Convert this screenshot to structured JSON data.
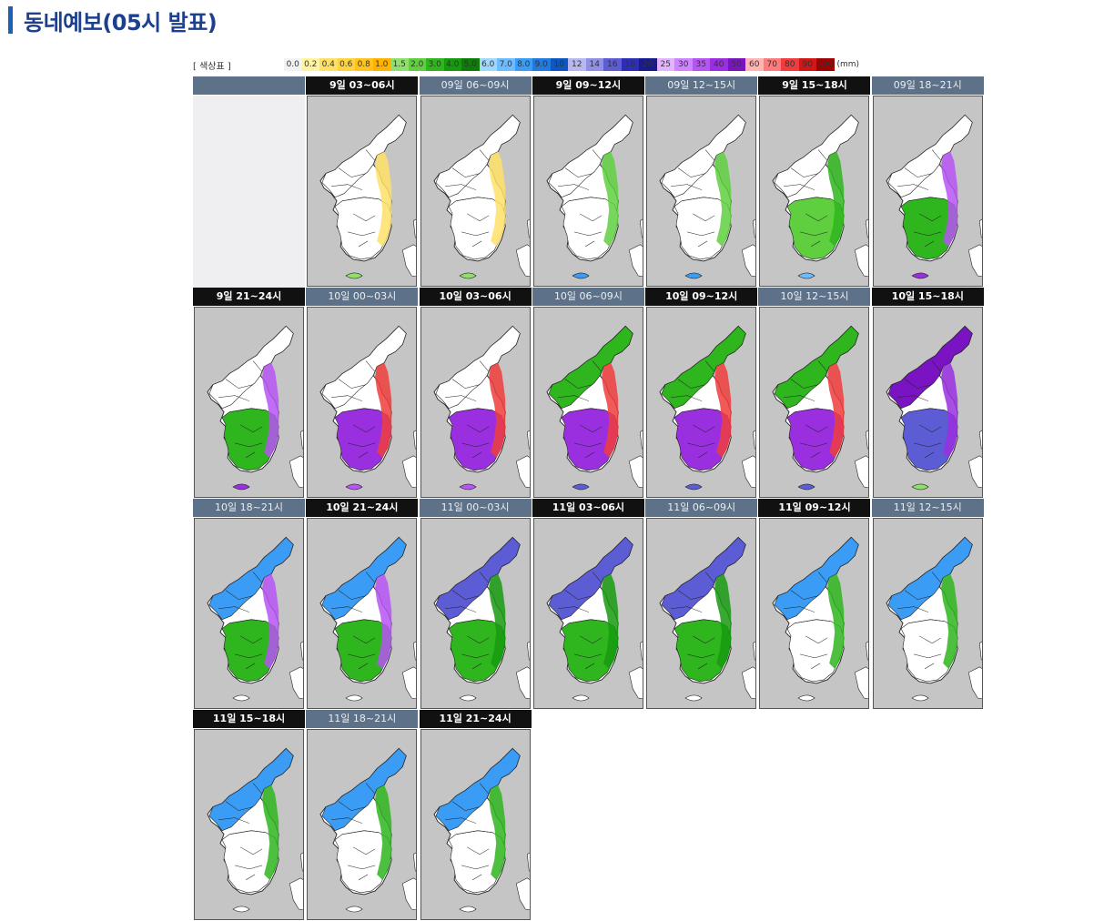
{
  "page": {
    "title": "동네예보(05시 발표)",
    "accent_color": "#1f5fb4",
    "title_color": "#1c3f8f"
  },
  "legend": {
    "label": "[ 색상표 ]",
    "unit": "(mm)",
    "steps": [
      {
        "label": "0.0",
        "color": "#f2f2f2"
      },
      {
        "label": "0.2",
        "color": "#fff3a0"
      },
      {
        "label": "0.4",
        "color": "#ffe066"
      },
      {
        "label": "0.6",
        "color": "#ffd23f"
      },
      {
        "label": "0.8",
        "color": "#ffc31f"
      },
      {
        "label": "1.0",
        "color": "#ffb300"
      },
      {
        "label": "1.5",
        "color": "#8fe06b"
      },
      {
        "label": "2.0",
        "color": "#5fcf3f"
      },
      {
        "label": "3.0",
        "color": "#2fb51e"
      },
      {
        "label": "4.0",
        "color": "#169a10"
      },
      {
        "label": "5.0",
        "color": "#0b7d08"
      },
      {
        "label": "6.0",
        "color": "#9fd7ff"
      },
      {
        "label": "7.0",
        "color": "#6cbcff"
      },
      {
        "label": "8.0",
        "color": "#3a9cf5"
      },
      {
        "label": "9.0",
        "color": "#1f7be0"
      },
      {
        "label": "10",
        "color": "#0d57c2"
      },
      {
        "label": "12",
        "color": "#b8b8f0"
      },
      {
        "label": "14",
        "color": "#8f8fe6"
      },
      {
        "label": "16",
        "color": "#5c5cd4"
      },
      {
        "label": "18",
        "color": "#2d2db8"
      },
      {
        "label": "20",
        "color": "#1a1a8f"
      },
      {
        "label": "25",
        "color": "#e3b3ff"
      },
      {
        "label": "30",
        "color": "#cf85ff"
      },
      {
        "label": "35",
        "color": "#b654f5"
      },
      {
        "label": "40",
        "color": "#9a2fe0"
      },
      {
        "label": "50",
        "color": "#7a14c2"
      },
      {
        "label": "60",
        "color": "#ffb3b3"
      },
      {
        "label": "70",
        "color": "#ff7a7a"
      },
      {
        "label": "80",
        "color": "#f03c3c"
      },
      {
        "label": "90",
        "color": "#d01616"
      },
      {
        "label": "100",
        "color": "#a00000"
      }
    ]
  },
  "panels": [
    {
      "label": "",
      "header": "empty",
      "fill": "empty"
    },
    {
      "label": "9일 03~06시",
      "header": "dark",
      "fill": "dry"
    },
    {
      "label": "09일 06~09시",
      "header": "slate",
      "fill": "dry"
    },
    {
      "label": "9일 09~12시",
      "header": "dark",
      "fill": "dry-east"
    },
    {
      "label": "09일 12~15시",
      "header": "slate",
      "fill": "dry-east"
    },
    {
      "label": "9일 15~18시",
      "header": "dark",
      "fill": "light"
    },
    {
      "label": "09일 18~21시",
      "header": "slate",
      "fill": "moderate"
    },
    {
      "label": "9일 21~24시",
      "header": "dark",
      "fill": "moderate"
    },
    {
      "label": "10일 00~03시",
      "header": "slate",
      "fill": "heavy-south"
    },
    {
      "label": "10일 03~06시",
      "header": "dark",
      "fill": "heavy-south"
    },
    {
      "label": "10일 06~09시",
      "header": "slate",
      "fill": "heavy"
    },
    {
      "label": "10일 09~12시",
      "header": "dark",
      "fill": "heavy"
    },
    {
      "label": "10일 12~15시",
      "header": "slate",
      "fill": "heavy"
    },
    {
      "label": "10일 15~18시",
      "header": "dark",
      "fill": "heavy-north"
    },
    {
      "label": "10일 18~21시",
      "header": "slate",
      "fill": "moderate-north"
    },
    {
      "label": "10일 21~24시",
      "header": "dark",
      "fill": "moderate-north"
    },
    {
      "label": "11일 00~03시",
      "header": "slate",
      "fill": "north"
    },
    {
      "label": "11일 03~06시",
      "header": "dark",
      "fill": "north"
    },
    {
      "label": "11일 06~09시",
      "header": "slate",
      "fill": "north"
    },
    {
      "label": "11일 09~12시",
      "header": "dark",
      "fill": "north-light"
    },
    {
      "label": "11일 12~15시",
      "header": "slate",
      "fill": "north-light"
    },
    {
      "label": "11일 15~18시",
      "header": "dark",
      "fill": "north-light"
    },
    {
      "label": "11일 18~21시",
      "header": "slate",
      "fill": "north-light"
    },
    {
      "label": "11일 21~24시",
      "header": "dark",
      "fill": "north-light"
    }
  ]
}
